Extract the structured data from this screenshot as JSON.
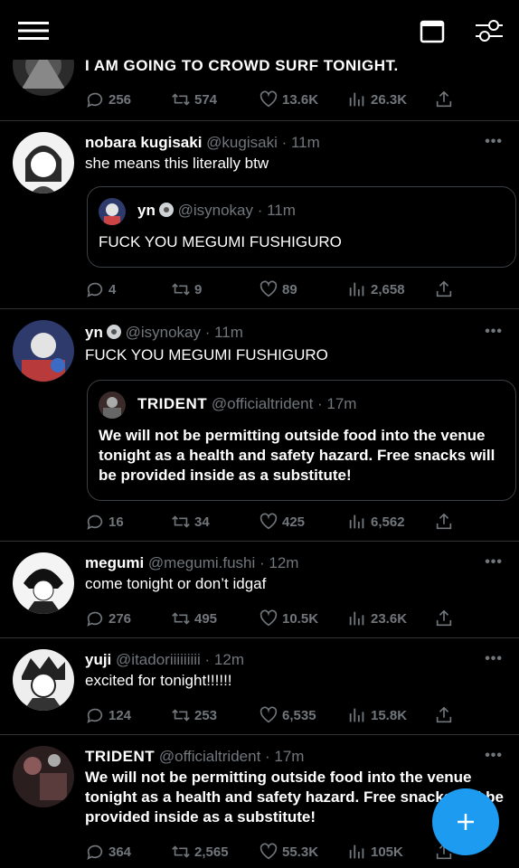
{
  "tweets": [
    {
      "text": "I AM GOING TO CROWD SURF TONIGHT.",
      "stats": {
        "replies": "256",
        "retweets": "574",
        "likes": "13.6K",
        "views": "26.3K"
      }
    },
    {
      "name": "nobara kugisaki",
      "handle": "@kugisaki · 11m",
      "text": "she means this literally btw",
      "quote": {
        "name": "yn",
        "handle": "@isynokay · 11m",
        "text": "FUCK YOU MEGUMI FUSHIGURO"
      },
      "stats": {
        "replies": "4",
        "retweets": "9",
        "likes": "89",
        "views": "2,658"
      }
    },
    {
      "name": "yn",
      "handle": "@isynokay · 11m",
      "text": "FUCK YOU MEGUMI FUSHIGURO",
      "quote": {
        "name": "TRIDENT",
        "handle": "@officialtrident · 17m",
        "text": "We will not be permitting outside food into the venue tonight as a health and safety hazard. Free snacks will be provided inside as a substitute!"
      },
      "stats": {
        "replies": "16",
        "retweets": "34",
        "likes": "425",
        "views": "6,562"
      }
    },
    {
      "name": "megumi",
      "handle": "@megumi.fushi · 12m",
      "text": "come tonight or don’t idgaf",
      "stats": {
        "replies": "276",
        "retweets": "495",
        "likes": "10.5K",
        "views": "23.6K"
      }
    },
    {
      "name": "yuji",
      "handle": "@itadoriiiiiiiii · 12m",
      "text": "excited for tonight!!!!!!",
      "stats": {
        "replies": "124",
        "retweets": "253",
        "likes": "6,535",
        "views": "15.8K"
      }
    },
    {
      "name": "TRIDENT",
      "handle": "@officialtrident · 17m",
      "text": "We will not be permitting outside food into the venue tonight as a health and safety hazard. Free snacks will be provided inside as a substitute!",
      "stats": {
        "replies": "364",
        "retweets": "2,565",
        "likes": "55.3K",
        "views": "105K"
      }
    }
  ],
  "more_glyph": "•••",
  "fab_glyph": "+",
  "icons": {
    "menu": "menu-icon",
    "calendar": "calendar-icon",
    "filter": "filter-icon",
    "reply": "reply-icon",
    "retweet": "retweet-icon",
    "like": "like-icon",
    "views": "views-icon",
    "share": "share-icon",
    "compose": "compose-icon"
  },
  "colors": {
    "background": "#000000",
    "text": "#e7e9ea",
    "muted": "#71767b",
    "accent": "#1d9bf0",
    "divider": "#2f3336"
  }
}
